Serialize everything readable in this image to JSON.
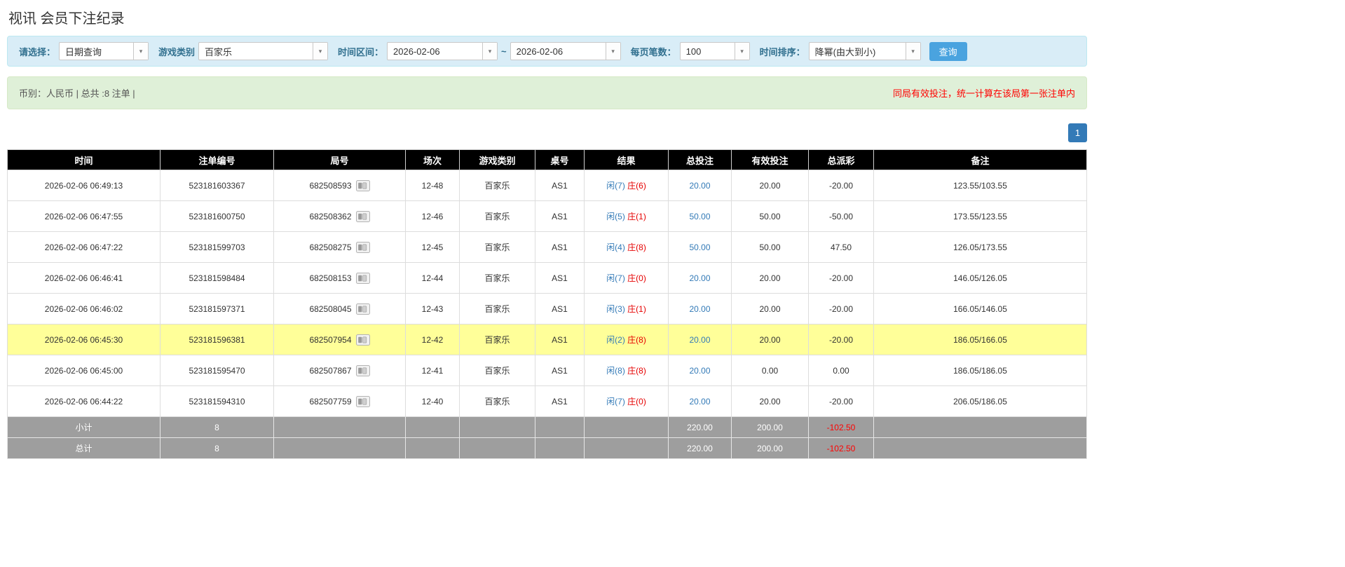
{
  "page": {
    "title": "视讯 会员下注纪录"
  },
  "filters": {
    "select_label": "请选择：",
    "select_value": "日期查询",
    "game_type_label": "游戏类别",
    "game_type_value": "百家乐",
    "time_range_label": "时间区间：",
    "date_from": "2026-02-06",
    "date_to": "2026-02-06",
    "tilde": "~",
    "page_size_label": "每页笔数：",
    "page_size_value": "100",
    "sort_label": "时间排序：",
    "sort_value": "降幂(由大到小)",
    "search_button": "查询"
  },
  "summary_bar": {
    "left_text": "币别：人民币 | 总共 :8 注单 |",
    "right_text": "同局有效投注，统一计算在该局第一张注单内"
  },
  "pagination": {
    "current_page": "1"
  },
  "colors": {
    "accent_blue": "#337ab7",
    "search_button_blue": "#4aa3df",
    "header_black": "#000000",
    "highlight_yellow": "#ffff99",
    "summary_gray": "#9e9e9e",
    "negative_red": "#ff0000",
    "filter_bar_blue": "#d9edf7",
    "notice_bar_green": "#dff0d8"
  },
  "table": {
    "headers": [
      "时间",
      "注单编号",
      "局号",
      "场次",
      "游戏类别",
      "桌号",
      "结果",
      "总投注",
      "有效投注",
      "总派彩",
      "备注"
    ],
    "rows": [
      {
        "time": "2026-02-06 06:49:13",
        "bet_id": "523181603367",
        "round_id": "682508593",
        "session": "12-48",
        "game_type": "百家乐",
        "table_no": "AS1",
        "result_player": "闲(7)",
        "result_banker": "庄(6)",
        "total_bet": "20.00",
        "valid_bet": "20.00",
        "payout": "-20.00",
        "remark": "123.55/103.55",
        "highlighted": false
      },
      {
        "time": "2026-02-06 06:47:55",
        "bet_id": "523181600750",
        "round_id": "682508362",
        "session": "12-46",
        "game_type": "百家乐",
        "table_no": "AS1",
        "result_player": "闲(5)",
        "result_banker": "庄(1)",
        "total_bet": "50.00",
        "valid_bet": "50.00",
        "payout": "-50.00",
        "remark": "173.55/123.55",
        "highlighted": false
      },
      {
        "time": "2026-02-06 06:47:22",
        "bet_id": "523181599703",
        "round_id": "682508275",
        "session": "12-45",
        "game_type": "百家乐",
        "table_no": "AS1",
        "result_player": "闲(4)",
        "result_banker": "庄(8)",
        "total_bet": "50.00",
        "valid_bet": "50.00",
        "payout": "47.50",
        "remark": "126.05/173.55",
        "highlighted": false
      },
      {
        "time": "2026-02-06 06:46:41",
        "bet_id": "523181598484",
        "round_id": "682508153",
        "session": "12-44",
        "game_type": "百家乐",
        "table_no": "AS1",
        "result_player": "闲(7)",
        "result_banker": "庄(0)",
        "total_bet": "20.00",
        "valid_bet": "20.00",
        "payout": "-20.00",
        "remark": "146.05/126.05",
        "highlighted": false
      },
      {
        "time": "2026-02-06 06:46:02",
        "bet_id": "523181597371",
        "round_id": "682508045",
        "session": "12-43",
        "game_type": "百家乐",
        "table_no": "AS1",
        "result_player": "闲(3)",
        "result_banker": "庄(1)",
        "total_bet": "20.00",
        "valid_bet": "20.00",
        "payout": "-20.00",
        "remark": "166.05/146.05",
        "highlighted": false
      },
      {
        "time": "2026-02-06 06:45:30",
        "bet_id": "523181596381",
        "round_id": "682507954",
        "session": "12-42",
        "game_type": "百家乐",
        "table_no": "AS1",
        "result_player": "闲(2)",
        "result_banker": "庄(8)",
        "total_bet": "20.00",
        "valid_bet": "20.00",
        "payout": "-20.00",
        "remark": "186.05/166.05",
        "highlighted": true
      },
      {
        "time": "2026-02-06 06:45:00",
        "bet_id": "523181595470",
        "round_id": "682507867",
        "session": "12-41",
        "game_type": "百家乐",
        "table_no": "AS1",
        "result_player": "闲(8)",
        "result_banker": "庄(8)",
        "total_bet": "20.00",
        "valid_bet": "0.00",
        "payout": "0.00",
        "remark": "186.05/186.05",
        "highlighted": false
      },
      {
        "time": "2026-02-06 06:44:22",
        "bet_id": "523181594310",
        "round_id": "682507759",
        "session": "12-40",
        "game_type": "百家乐",
        "table_no": "AS1",
        "result_player": "闲(7)",
        "result_banker": "庄(0)",
        "total_bet": "20.00",
        "valid_bet": "20.00",
        "payout": "-20.00",
        "remark": "206.05/186.05",
        "highlighted": false
      }
    ],
    "summary_rows": [
      {
        "label": "小计",
        "count": "8",
        "total_bet": "220.00",
        "valid_bet": "200.00",
        "payout": "-102.50"
      },
      {
        "label": "总计",
        "count": "8",
        "total_bet": "220.00",
        "valid_bet": "200.00",
        "payout": "-102.50"
      }
    ]
  }
}
